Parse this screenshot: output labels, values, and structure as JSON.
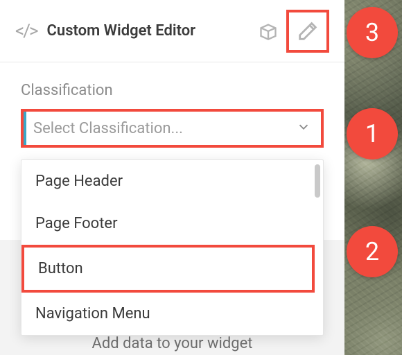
{
  "header": {
    "title": "Custom Widget Editor"
  },
  "form": {
    "classification_label": "Classification",
    "classification_placeholder": "Select Classification...",
    "options": {
      "page_header": "Page Header",
      "page_footer": "Page Footer",
      "button": "Button",
      "navigation_menu": "Navigation Menu"
    }
  },
  "hint": "Add data to your widget",
  "callouts": {
    "c1": "1",
    "c2": "2",
    "c3": "3"
  }
}
